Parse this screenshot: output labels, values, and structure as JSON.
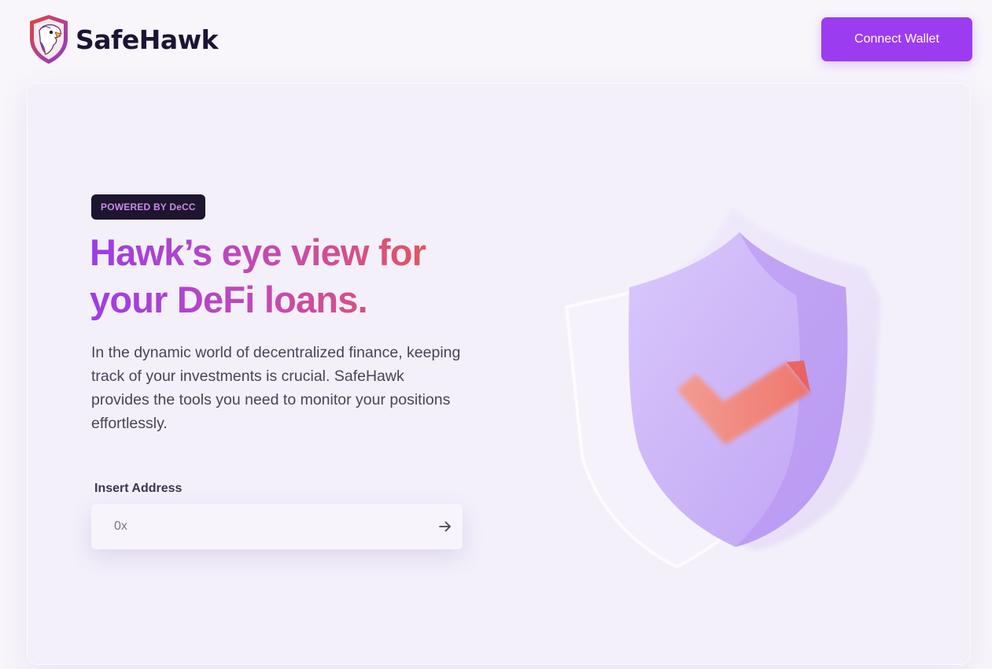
{
  "header": {
    "brand_name": "SafeHawk",
    "connect_label": "Connect Wallet"
  },
  "hero": {
    "badge": "POWERED BY DeCC",
    "headline_line1": "Hawk’s eye view for",
    "headline_line2": "your DeFi loans.",
    "description": "In the dynamic world of decentralized finance, keeping track of your investments is crucial. SafeHawk provides the tools you need to monitor your positions effortlessly."
  },
  "address_form": {
    "label": "Insert Address",
    "placeholder": "0x",
    "value": "",
    "submit_icon": "arrow-right-icon"
  },
  "icons": {
    "logo": "hawk-shield-logo-icon",
    "illustration": "shield-check-icon"
  },
  "colors": {
    "accent": "#9c3cf0",
    "badge_bg": "#1e1530",
    "badge_text": "#c98ee6",
    "gradient_start": "#9b3de8",
    "gradient_end": "#ef5a3c",
    "background": "#f8f5fb"
  }
}
